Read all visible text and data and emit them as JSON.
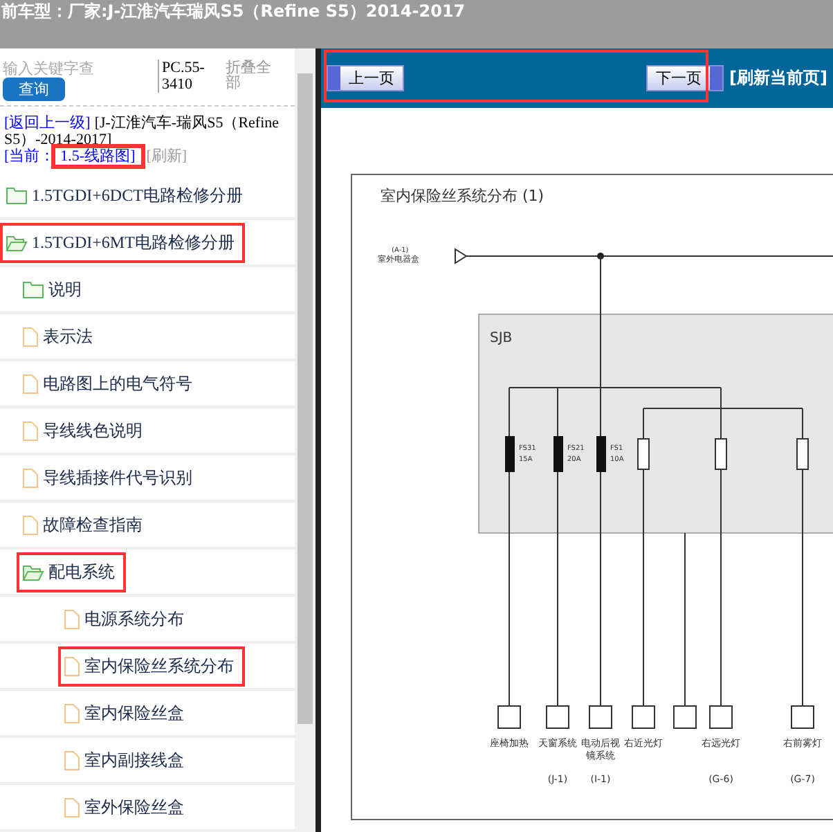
{
  "header": {
    "title": "前车型：厂家:J-江淮汽车瑞风S5（Refine S5）2014-2017"
  },
  "sidebar": {
    "search": {
      "placeholder": "输入关键字查",
      "button": "查询"
    },
    "code": "PC.55-3410",
    "collapse_all": "折叠全部",
    "breadcrumb": {
      "back": "[返回上一级]",
      "path": "[J-江淮汽车-瑞风S5（Refine S5）-2014-2017]",
      "current_label": "[当前：",
      "current": "1.5-线路图]",
      "current_highlighted": true,
      "refresh": "[刷新]"
    },
    "tree": [
      {
        "label": "1.5TGDI+6DCT电路检修分册",
        "kind": "folder",
        "expanded": false,
        "highlighted": false
      },
      {
        "label": "1.5TGDI+6MT电路检修分册",
        "kind": "folder",
        "expanded": true,
        "highlighted": true,
        "children": [
          {
            "label": "说明",
            "kind": "folder",
            "expanded": false,
            "highlighted": false
          },
          {
            "label": "表示法",
            "kind": "file",
            "highlighted": false
          },
          {
            "label": "电路图上的电气符号",
            "kind": "file",
            "highlighted": false
          },
          {
            "label": "导线线色说明",
            "kind": "file",
            "highlighted": false
          },
          {
            "label": "导线插接件代号识别",
            "kind": "file",
            "highlighted": false
          },
          {
            "label": "故障检查指南",
            "kind": "file",
            "highlighted": false
          },
          {
            "label": "配电系统",
            "kind": "folder",
            "expanded": true,
            "highlighted": true,
            "children": [
              {
                "label": "电源系统分布",
                "kind": "file",
                "highlighted": false
              },
              {
                "label": "室内保险丝系统分布",
                "kind": "file",
                "highlighted": true
              },
              {
                "label": "室内保险丝盒",
                "kind": "file",
                "highlighted": false
              },
              {
                "label": "室内副接线盒",
                "kind": "file",
                "highlighted": false
              },
              {
                "label": "室外保险丝盒",
                "kind": "file",
                "highlighted": false
              }
            ]
          }
        ]
      }
    ]
  },
  "nav": {
    "prev": "上一页",
    "next": "下一页",
    "refresh": "[刷新当前页]",
    "highlighted": true
  },
  "diagram": {
    "title": "室内保险丝系统分布 (1)",
    "source": "室外电器盒",
    "source_code": "(A-1)",
    "box": "SJB",
    "fuses": [
      {
        "name": "FS31",
        "rating": "15A"
      },
      {
        "name": "FS21",
        "rating": "20A"
      },
      {
        "name": "FS1",
        "rating": "10A"
      }
    ],
    "loads": [
      {
        "label": "座椅加热"
      },
      {
        "label": "天窗系统",
        "code": "(J-1)"
      },
      {
        "label": "电动后视镜系统",
        "code": "(I-1)"
      },
      {
        "label": "右近光灯"
      },
      {
        "label": "右远光灯",
        "code": "(G-6)"
      },
      {
        "label": "右前雾灯",
        "code": "(G-7)"
      }
    ]
  }
}
